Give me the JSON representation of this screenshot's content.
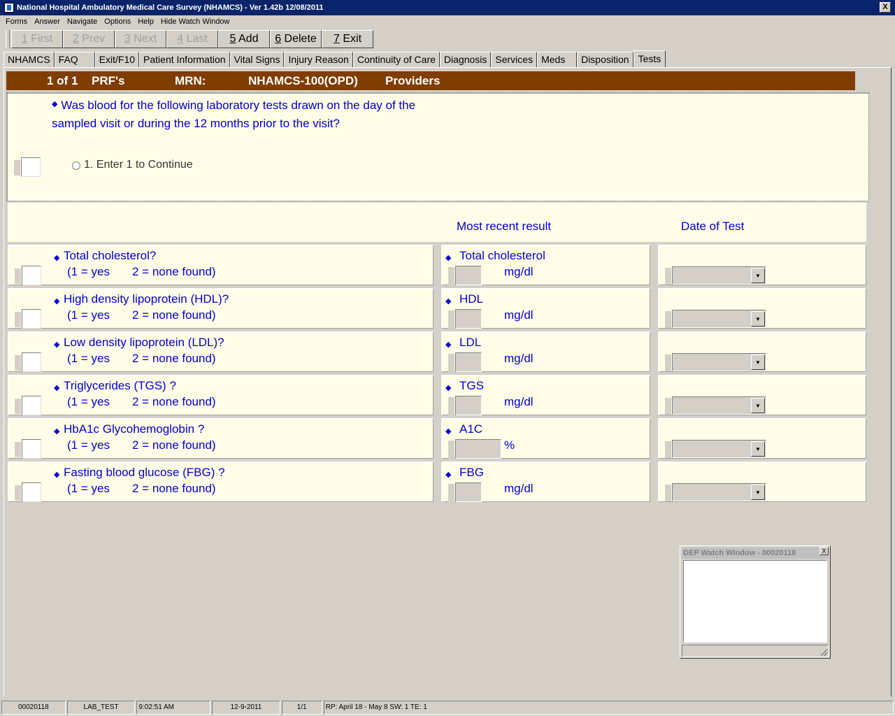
{
  "window": {
    "title": "National Hospital Ambulatory Medical Care Survey (NHAMCS) - Ver 1.42b 12/08/2011",
    "close_glyph": "X"
  },
  "menu": [
    "Forms",
    "Answer",
    "Navigate",
    "Options",
    "Help",
    "Hide Watch Window"
  ],
  "toolbar": [
    {
      "key": "1",
      "label": " First",
      "enabled": false
    },
    {
      "key": "2",
      "label": " Prev",
      "enabled": false
    },
    {
      "key": "3",
      "label": " Next",
      "enabled": false
    },
    {
      "key": "4",
      "label": " Last",
      "enabled": false
    },
    {
      "key": "5",
      "label": " Add",
      "enabled": true
    },
    {
      "key": "6",
      "label": " Delete",
      "enabled": true
    },
    {
      "key": "7",
      "label": " Exit",
      "enabled": true
    }
  ],
  "tabs": [
    "NHAMCS",
    "FAQ",
    "Exit/F10",
    "Patient Information",
    "Vital Signs",
    "Injury Reason",
    "Continuity of Care",
    "Diagnosis",
    "Services",
    "Meds",
    "Disposition",
    "Tests"
  ],
  "active_tab": "Tests",
  "header": {
    "record": "1 of 1",
    "prf": "PRF's",
    "mrn": "MRN:",
    "form": "NHAMCS-100(OPD)",
    "providers": "Providers"
  },
  "question": {
    "line1": "Was blood for the following laboratory tests drawn on the day of the",
    "line2": "sampled visit or during the 12 months prior to the visit?",
    "option": "1. Enter 1 to Continue"
  },
  "columns": {
    "result": "Most recent result",
    "date": "Date of Test"
  },
  "tests": [
    {
      "question": "Total cholesterol?",
      "hint_yes": "(1 = yes",
      "hint_no": "2 = none found)",
      "result_label": "Total cholesterol",
      "unit": "mg/dl"
    },
    {
      "question": "High density lipoprotein (HDL)?",
      "hint_yes": "(1 = yes",
      "hint_no": "2 = none found)",
      "result_label": "HDL",
      "unit": "mg/dl"
    },
    {
      "question": "Low density lipoprotein (LDL)?",
      "hint_yes": "(1 = yes",
      "hint_no": "2 = none found)",
      "result_label": "LDL",
      "unit": "mg/dl"
    },
    {
      "question": "Triglycerides (TGS) ?",
      "hint_yes": "(1 = yes",
      "hint_no": "2 = none found)",
      "result_label": "TGS",
      "unit": "mg/dl"
    },
    {
      "question": "HbA1c Glycohemoglobin ?",
      "hint_yes": "(1 = yes",
      "hint_no": "2 = none found)",
      "result_label": "A1C",
      "unit": "%"
    },
    {
      "question": "Fasting blood glucose (FBG) ?",
      "hint_yes": "(1 = yes",
      "hint_no": "2 = none found)",
      "result_label": "FBG",
      "unit": "mg/dl"
    }
  ],
  "watch": {
    "title": "DEP Watch Window - 00020118",
    "close_glyph": "X"
  },
  "status": {
    "id": "00020118",
    "field": "LAB_TEST",
    "time": "9:02:51 AM",
    "date": "12-9-2011",
    "page": "1/1",
    "info": "RP: April 18 - May 8   SW: 1   TE: 1"
  },
  "colors": {
    "header_bg": "#803d00",
    "panel_bg": "#fffde7",
    "text_blue": "#0000cc",
    "titlebar": "#0a246a"
  },
  "icons": {
    "bullet": "diamond-icon",
    "dropdown": "chevron-down-icon",
    "app": "app-icon"
  }
}
